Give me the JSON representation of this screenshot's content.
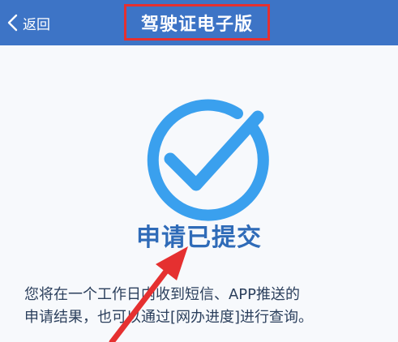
{
  "navbar": {
    "back_label": "返回",
    "title": "驾驶证电子版",
    "background_color": "#3d74c6",
    "highlight_color": "#e53030"
  },
  "status": {
    "icon": "checkmark-circle-icon",
    "title": "申请已提交",
    "accent_color": "#3aa0ee"
  },
  "description": {
    "line1": "您将在一个工作日内收到短信、APP推送的",
    "line2": "申请结果，也可以通过[网办进度]进行查询。"
  },
  "annotation": {
    "icon": "red-arrow-icon",
    "color": "#e53030"
  }
}
